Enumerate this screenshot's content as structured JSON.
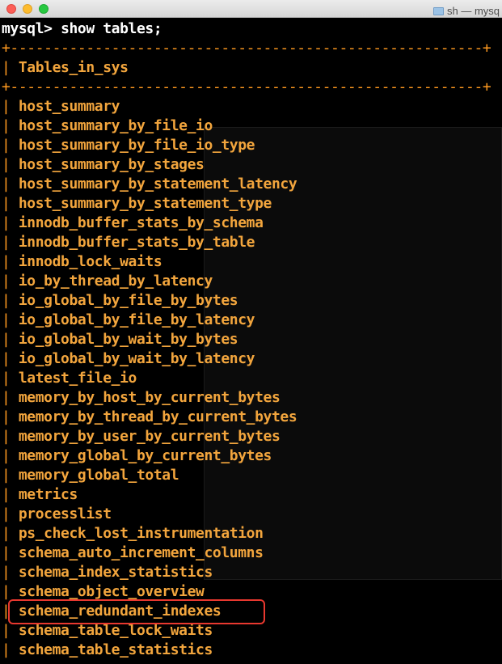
{
  "window": {
    "title": "sh — mysq"
  },
  "terminal": {
    "prompt": "mysql>",
    "command": "show tables;",
    "border": "+--------------------------------------------------------+",
    "header": "Tables_in_sys",
    "rows": [
      "host_summary",
      "host_summary_by_file_io",
      "host_summary_by_file_io_type",
      "host_summary_by_stages",
      "host_summary_by_statement_latency",
      "host_summary_by_statement_type",
      "innodb_buffer_stats_by_schema",
      "innodb_buffer_stats_by_table",
      "innodb_lock_waits",
      "io_by_thread_by_latency",
      "io_global_by_file_by_bytes",
      "io_global_by_file_by_latency",
      "io_global_by_wait_by_bytes",
      "io_global_by_wait_by_latency",
      "latest_file_io",
      "memory_by_host_by_current_bytes",
      "memory_by_thread_by_current_bytes",
      "memory_by_user_by_current_bytes",
      "memory_global_by_current_bytes",
      "memory_global_total",
      "metrics",
      "processlist",
      "ps_check_lost_instrumentation",
      "schema_auto_increment_columns",
      "schema_index_statistics",
      "schema_object_overview",
      "schema_redundant_indexes",
      "schema_table_lock_waits",
      "schema_table_statistics"
    ],
    "highlighted_row": "schema_redundant_indexes"
  },
  "colors": {
    "background": "#000000",
    "text": "#f2a53d",
    "prompt": "#ffffff",
    "highlight": "#e8382f"
  }
}
